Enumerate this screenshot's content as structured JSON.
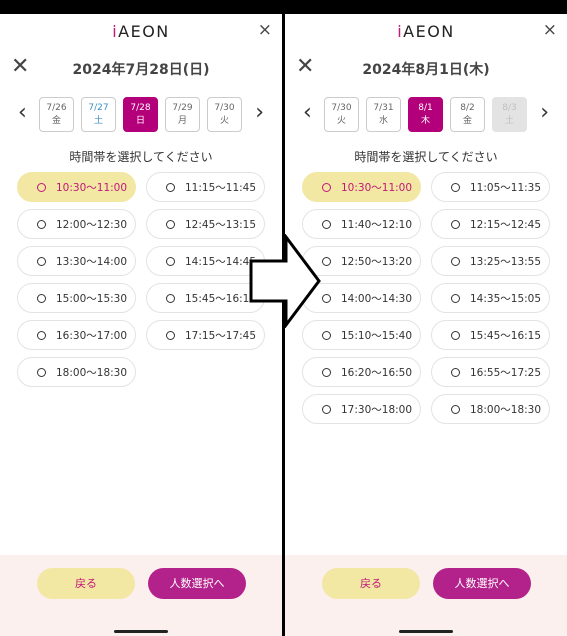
{
  "logo": "AEON",
  "logo_prefix": "i",
  "close_glyph": "×",
  "back_glyph": "✕",
  "arrow_left": "‹",
  "arrow_right": "›",
  "instruction": "時間帯を選択してください",
  "buttons": {
    "back": "戻る",
    "next": "人数選択へ"
  },
  "colors": {
    "accent": "#b3007a",
    "selected_slot_bg": "#f2e7a3",
    "footer_bg": "#fcf0ee",
    "saturday": "#3a8fc6"
  },
  "panels": [
    {
      "date_title": "2024年7月28日(日)",
      "dates": [
        {
          "date": "7/26",
          "day": "金",
          "state": "normal"
        },
        {
          "date": "7/27",
          "day": "土",
          "state": "saturday"
        },
        {
          "date": "7/28",
          "day": "日",
          "state": "selected"
        },
        {
          "date": "7/29",
          "day": "月",
          "state": "normal"
        },
        {
          "date": "7/30",
          "day": "火",
          "state": "normal"
        }
      ],
      "slots": [
        {
          "time": "10:30〜11:00",
          "selected": true
        },
        {
          "time": "11:15〜11:45",
          "selected": false
        },
        {
          "time": "12:00〜12:30",
          "selected": false
        },
        {
          "time": "12:45〜13:15",
          "selected": false
        },
        {
          "time": "13:30〜14:00",
          "selected": false
        },
        {
          "time": "14:15〜14:45",
          "selected": false
        },
        {
          "time": "15:00〜15:30",
          "selected": false
        },
        {
          "time": "15:45〜16:15",
          "selected": false
        },
        {
          "time": "16:30〜17:00",
          "selected": false
        },
        {
          "time": "17:15〜17:45",
          "selected": false
        },
        {
          "time": "18:00〜18:30",
          "selected": false
        }
      ]
    },
    {
      "date_title": "2024年8月1日(木)",
      "dates": [
        {
          "date": "7/30",
          "day": "火",
          "state": "normal"
        },
        {
          "date": "7/31",
          "day": "水",
          "state": "normal"
        },
        {
          "date": "8/1",
          "day": "木",
          "state": "selected"
        },
        {
          "date": "8/2",
          "day": "金",
          "state": "normal"
        },
        {
          "date": "8/3",
          "day": "土",
          "state": "disabled"
        }
      ],
      "slots": [
        {
          "time": "10:30〜11:00",
          "selected": true
        },
        {
          "time": "11:05〜11:35",
          "selected": false
        },
        {
          "time": "11:40〜12:10",
          "selected": false
        },
        {
          "time": "12:15〜12:45",
          "selected": false
        },
        {
          "time": "12:50〜13:20",
          "selected": false
        },
        {
          "time": "13:25〜13:55",
          "selected": false
        },
        {
          "time": "14:00〜14:30",
          "selected": false
        },
        {
          "time": "14:35〜15:05",
          "selected": false
        },
        {
          "time": "15:10〜15:40",
          "selected": false
        },
        {
          "time": "15:45〜16:15",
          "selected": false
        },
        {
          "time": "16:20〜16:50",
          "selected": false
        },
        {
          "time": "16:55〜17:25",
          "selected": false
        },
        {
          "time": "17:30〜18:00",
          "selected": false
        },
        {
          "time": "18:00〜18:30",
          "selected": false
        }
      ]
    }
  ]
}
